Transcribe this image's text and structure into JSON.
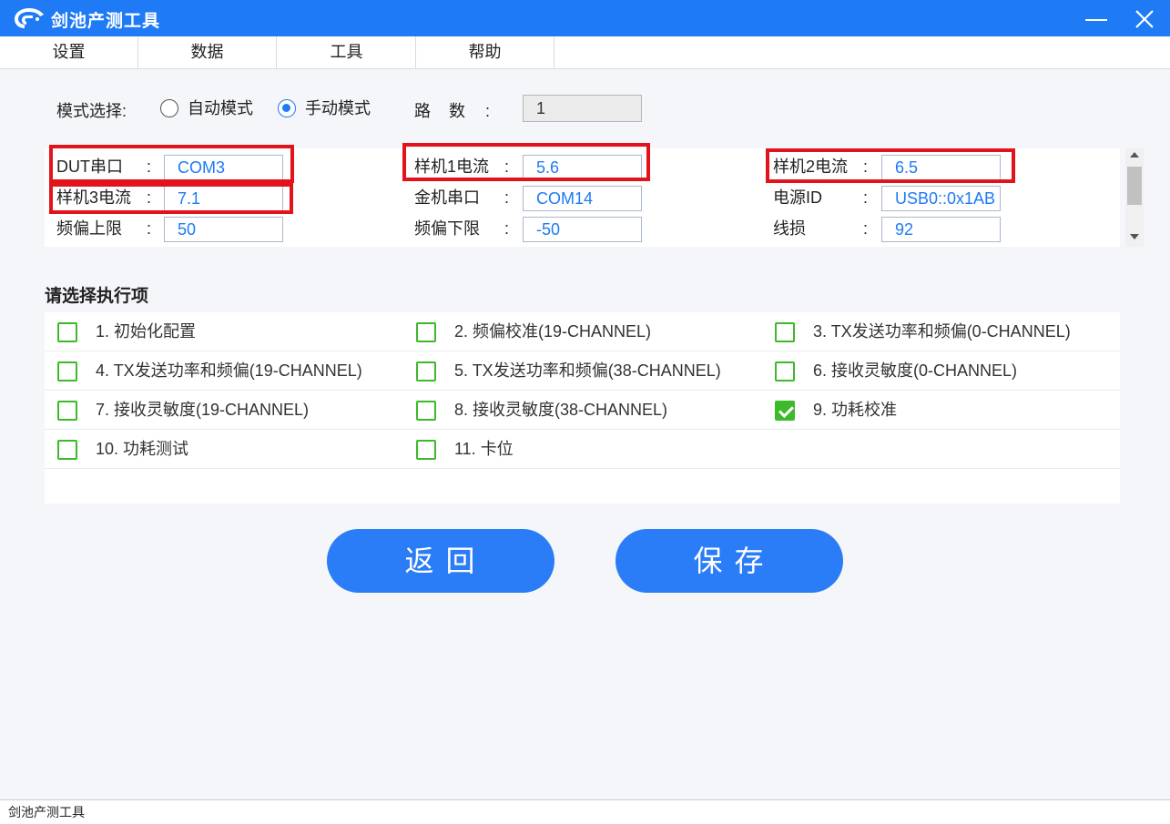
{
  "app": {
    "title": "剑池产测工具"
  },
  "menu": [
    "设置",
    "数据",
    "工具",
    "帮助"
  ],
  "mode": {
    "label": "模式选择:",
    "options": [
      "自动模式",
      "手动模式"
    ],
    "selected": "手动模式"
  },
  "lu": {
    "label": "路    数",
    "colon": ":",
    "value": "1"
  },
  "params": [
    {
      "label": "DUT串口",
      "value": "COM3",
      "highlighted": true
    },
    {
      "label": "样机1电流",
      "value": "5.6",
      "highlighted": true
    },
    {
      "label": "样机2电流",
      "value": "6.5",
      "highlighted": true
    },
    {
      "label": "样机3电流",
      "value": "7.1",
      "highlighted": true
    },
    {
      "label": "金机串口",
      "value": "COM14",
      "highlighted": false
    },
    {
      "label": "电源ID",
      "value": "USB0::0x1AB",
      "highlighted": false
    },
    {
      "label": "频偏上限",
      "value": "50",
      "highlighted": false
    },
    {
      "label": "频偏下限",
      "value": "-50",
      "highlighted": false
    },
    {
      "label": "线损",
      "value": "92",
      "highlighted": false
    }
  ],
  "colon": ":",
  "exec": {
    "title": "请选择执行项",
    "items": [
      {
        "label": "1. 初始化配置",
        "checked": false
      },
      {
        "label": "2. 频偏校准(19-CHANNEL)",
        "checked": false
      },
      {
        "label": "3. TX发送功率和频偏(0-CHANNEL)",
        "checked": false
      },
      {
        "label": "4. TX发送功率和频偏(19-CHANNEL)",
        "checked": false
      },
      {
        "label": "5. TX发送功率和频偏(38-CHANNEL)",
        "checked": false
      },
      {
        "label": "6. 接收灵敏度(0-CHANNEL)",
        "checked": false
      },
      {
        "label": "7. 接收灵敏度(19-CHANNEL)",
        "checked": false
      },
      {
        "label": "8. 接收灵敏度(38-CHANNEL)",
        "checked": false
      },
      {
        "label": "9. 功耗校准",
        "checked": true
      },
      {
        "label": "10. 功耗测试",
        "checked": false
      },
      {
        "label": "11. 卡位",
        "checked": false
      }
    ]
  },
  "buttons": {
    "back": "返 回",
    "save": "保 存"
  },
  "status": {
    "text": "剑池产测工具"
  },
  "colors": {
    "titlebar": "#1e7af5",
    "button": "#2a7df6",
    "highlight": "#e3131b",
    "checkbox": "#3dba2a",
    "value_text": "#1e7af5"
  }
}
